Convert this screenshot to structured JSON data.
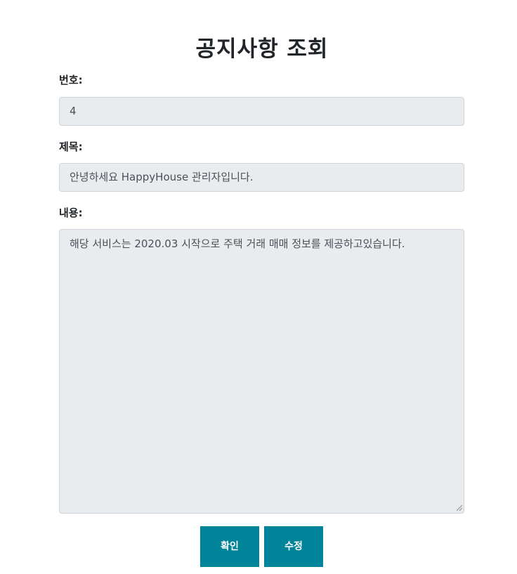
{
  "page": {
    "title": "공지사항 조회"
  },
  "form": {
    "number": {
      "label": "번호:",
      "value": "4"
    },
    "subject": {
      "label": "제목:",
      "value": "안녕하세요 HappyHouse 관리자입니다."
    },
    "content": {
      "label": "내용:",
      "value": "해당 서비스는 2020.03 시작으로 주택 거래 매매 정보를 제공하고있습니다."
    }
  },
  "buttons": {
    "confirm_label": "확인",
    "edit_label": "수정"
  },
  "colors": {
    "button_bg": "#00849a",
    "field_bg": "#e9ecef",
    "field_border": "#ced4da"
  }
}
